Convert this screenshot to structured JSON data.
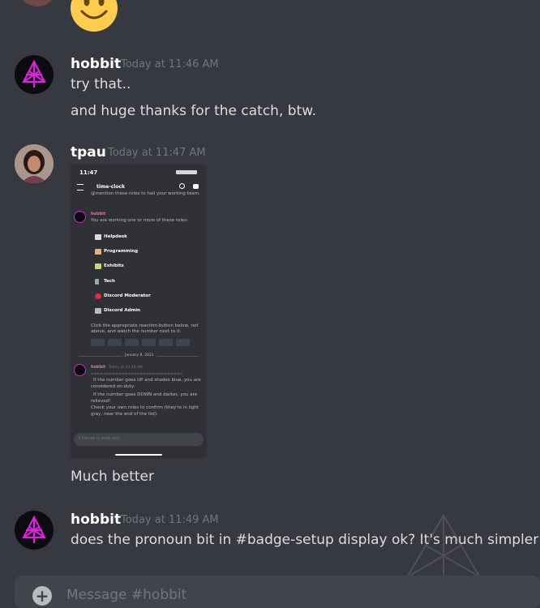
{
  "messages": [
    {
      "username": "hobbit",
      "timestamp": "Today at 11:46 AM",
      "lines": [
        "try that..",
        "and huge thanks for the catch, btw."
      ]
    },
    {
      "username": "tpau",
      "timestamp": "Today at 11:47 AM",
      "caption": "Much better",
      "screenshot": {
        "status_time": "11:47",
        "channel": "time-clock",
        "mention_line": "@mention these roles to hail your working team.",
        "bot_name": "hobbit",
        "bot_intro": "You are working one or more of these roles:",
        "roles": [
          "Helpdesk",
          "Programming",
          "Exhibits",
          "Tech",
          "Discord Moderator",
          "Discord Admin"
        ],
        "instruction_line1": "Click the appropriate reaction-button below, not",
        "instruction_line2": "above, and watch the number next to it.",
        "date_divider": "January 8, 2021",
        "bot_time": "Today at 10:38 AM",
        "bot_lines": [
          "==============================",
          "If the number goes UP and shades blue, you are",
          "considered on-duty.",
          "If the number goes DOWN and darker, you are",
          "relieved!",
          "Check your own roles to confirm (they're in light",
          "gray, near the end of the list)."
        ],
        "input_placeholder": "Channel is read-only"
      }
    },
    {
      "username": "hobbit",
      "timestamp": "Today at 11:49 AM",
      "lines": [
        "does the pronoun bit in #badge-setup display ok?  It's much simpler"
      ]
    }
  ],
  "composer": {
    "placeholder": "Message #hobbit"
  },
  "colors": {
    "background": "#36393f",
    "username": "#ffffff",
    "timestamp": "#72767d",
    "message": "#dcddde",
    "hobbit_logo": "#e01fe0"
  }
}
